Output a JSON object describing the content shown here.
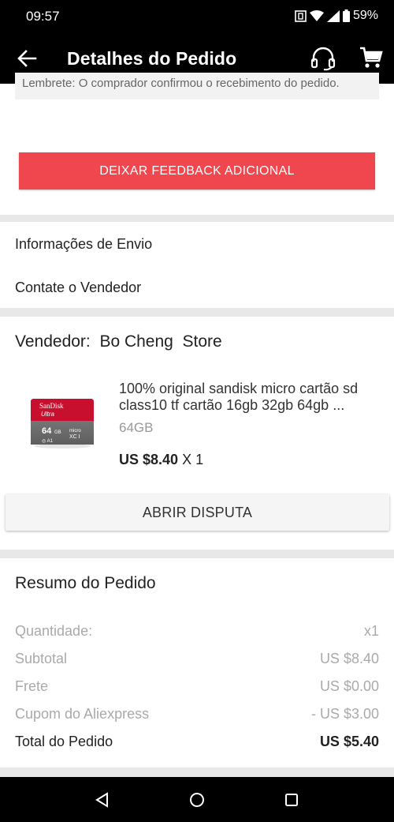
{
  "status": {
    "time": "09:57",
    "battery": "59%"
  },
  "header": {
    "title": "Detalhes do Pedido"
  },
  "reminder": {
    "text": "Lembrete: O comprador confirmou o recebimento do pedido."
  },
  "feedback": {
    "label": "DEIXAR FEEDBACK ADICIONAL"
  },
  "links": {
    "shipping": "Informações de Envio",
    "contact": "Contate o Vendedor"
  },
  "seller": {
    "label": "Vendedor:",
    "name": "Bo Cheng  Store"
  },
  "product": {
    "title": "100% original sandisk micro cartão sd class10 tf cartão 16gb 32gb 64gb ...",
    "variant": "64GB",
    "price": "US $8.40",
    "quantity": "X 1",
    "card_brand": "SanDisk",
    "card_line": "Ultra",
    "card_capacity": "64"
  },
  "dispute": {
    "label": "ABRIR DISPUTA"
  },
  "summary": {
    "title": "Resumo do Pedido",
    "rows": [
      {
        "label": "Quantidade:",
        "value": "x1"
      },
      {
        "label": "Subtotal",
        "value": "US $8.40"
      },
      {
        "label": "Frete",
        "value": "US $0.00"
      },
      {
        "label": "Cupom do Aliexpress",
        "value": "- US $3.00"
      }
    ],
    "total": {
      "label": "Total do Pedido",
      "value": "US $5.40"
    }
  },
  "colors": {
    "accent": "#f0464d",
    "bars": "#000000"
  },
  "icons": [
    "back-arrow-icon",
    "headset-icon",
    "cart-icon",
    "nav-back-icon",
    "nav-home-icon",
    "nav-recents-icon"
  ]
}
